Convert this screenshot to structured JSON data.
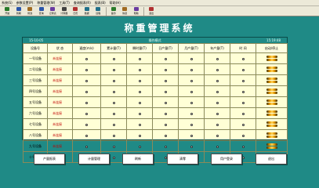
{
  "menu": [
    "系统(S)",
    "参数设置(P)",
    "称重管理(W)",
    "工具(T)",
    "查询报表(R)",
    "报表(B)",
    "帮助(H)"
  ],
  "toolbar": [
    {
      "label": "开始",
      "icon": "start-icon",
      "color": "#2a7a2a"
    },
    {
      "label": "到期",
      "icon": "due-icon",
      "color": "#2a55aa"
    },
    {
      "label": "修改",
      "icon": "edit-icon",
      "color": "#a06a20"
    },
    {
      "label": "查询",
      "icon": "search-icon",
      "color": "#2a55aa"
    },
    {
      "label": "记录表",
      "icon": "record-icon",
      "color": "#6a3aa0"
    },
    {
      "label": "计算器",
      "icon": "calculator-icon",
      "color": "#404040"
    },
    {
      "label": "日历",
      "icon": "calendar-icon",
      "color": "#b03030"
    },
    {
      "label": "数据",
      "icon": "data-icon",
      "color": "#20708a"
    },
    {
      "label": "远程",
      "icon": "remote-icon",
      "color": "#20708a"
    },
    {
      "label": "备份",
      "icon": "backup-icon",
      "color": "#2a7a2a"
    },
    {
      "label": "恢复",
      "icon": "restore-icon",
      "color": "#a06a20"
    },
    {
      "label": "帮助",
      "icon": "help-icon",
      "color": "#6a3aa0"
    },
    {
      "label": "退出",
      "icon": "exit-icon",
      "color": "#b03030"
    }
  ],
  "title": "称重管理系统",
  "status": {
    "date": "15-10-05",
    "mode": "操作模式",
    "time": "15:19:48"
  },
  "columns": [
    "设备号",
    "状 态",
    "速度(m/s)",
    "累计量(T)",
    "瞬时量(T)",
    "日产量(T)",
    "月产量(T)",
    "年产量(T)",
    "时 间",
    "启动/停止"
  ],
  "rows": [
    {
      "name": "一号设备",
      "state": "未连接"
    },
    {
      "name": "二号设备",
      "state": "未连接"
    },
    {
      "name": "三号设备",
      "state": "未连接"
    },
    {
      "name": "四号设备",
      "state": "未连接"
    },
    {
      "name": "五号设备",
      "state": "未连接"
    },
    {
      "name": "六号设备",
      "state": "未连接"
    },
    {
      "name": "七号设备",
      "state": "未连接"
    },
    {
      "name": "八号设备",
      "state": "未连接"
    },
    {
      "name": "九号设备",
      "state": "未连接"
    },
    {
      "name": "十号设备",
      "state": "未连接"
    }
  ],
  "buttons": [
    {
      "label": "产量报表",
      "name": "production-report-button"
    },
    {
      "label": "计量管理",
      "name": "metering-button"
    },
    {
      "label": "刷新",
      "name": "refresh-button"
    },
    {
      "label": "清零",
      "name": "reset-button"
    },
    {
      "label": "用户登录",
      "name": "login-button"
    },
    {
      "label": "退出",
      "name": "exit-button"
    }
  ]
}
